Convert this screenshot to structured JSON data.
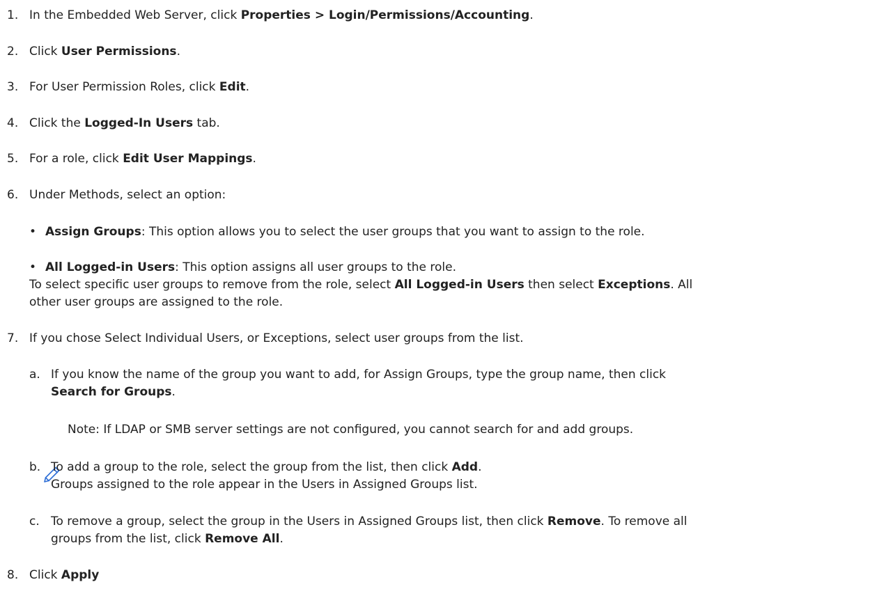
{
  "steps": [
    {
      "num": "1.",
      "pre": "In the Embedded Web Server, click ",
      "bold": "Properties > Login/Permissions/Accounting",
      "post": "."
    },
    {
      "num": "2.",
      "pre": "Click ",
      "bold": "User Permissions",
      "post": "."
    },
    {
      "num": "3.",
      "pre": "For User Permission Roles, click ",
      "bold": "Edit",
      "post": "."
    },
    {
      "num": "4.",
      "pre": "Click the ",
      "bold": "Logged-In Users",
      "post": " tab."
    },
    {
      "num": "5.",
      "pre": "For a role, click ",
      "bold": "Edit User Mappings",
      "post": "."
    },
    {
      "num": "6.",
      "text": "Under Methods, select an option:"
    },
    {
      "num": "7.",
      "text": "If you chose Select Individual Users, or Exceptions, select user groups from the list."
    },
    {
      "num": "8.",
      "pre": "Click ",
      "bold": "Apply"
    }
  ],
  "bullets": [
    {
      "marker": "•",
      "bold": "Assign Groups",
      "rest": ": This option allows you to select the user groups that you want to assign to the role."
    },
    {
      "marker": "•",
      "bold": "All Logged-in Users",
      "rest": ": This option assigns all user groups to the role.",
      "cont1_pre": "To select specific user groups to remove from the role, select ",
      "cont1_bold1": "All Logged-in Users",
      "cont1_mid": " then select ",
      "cont1_bold2": "Exceptions",
      "cont1_post": ". All",
      "cont2": "other user groups are assigned to the role."
    }
  ],
  "substeps": [
    {
      "letter": "a.",
      "line1": "If you know the name of the group you want to add, for Assign Groups, type the group name, then click",
      "line2_bold": "Search for Groups",
      "line2_post": "."
    },
    {
      "letter": "b.",
      "line1_pre": "To add a group to the role, select the group from the list, then click ",
      "line1_bold": "Add",
      "line1_post": ".",
      "line2": "Groups assigned to the role appear in the Users in Assigned Groups list."
    },
    {
      "letter": "c.",
      "line1_pre": "To remove a group, select the group in the Users in Assigned Groups list, then click ",
      "line1_bold": "Remove",
      "line1_post": ". To remove all",
      "line2_pre": "groups from the list, click ",
      "line2_bold": "Remove All",
      "line2_post": "."
    }
  ],
  "note": {
    "icon": "pencil-icon",
    "text": "Note: If LDAP or SMB server settings are not configured, you cannot search for and add groups."
  },
  "colors": {
    "text": "#222222",
    "note_icon": "#2f6fd6",
    "background": "#ffffff"
  }
}
